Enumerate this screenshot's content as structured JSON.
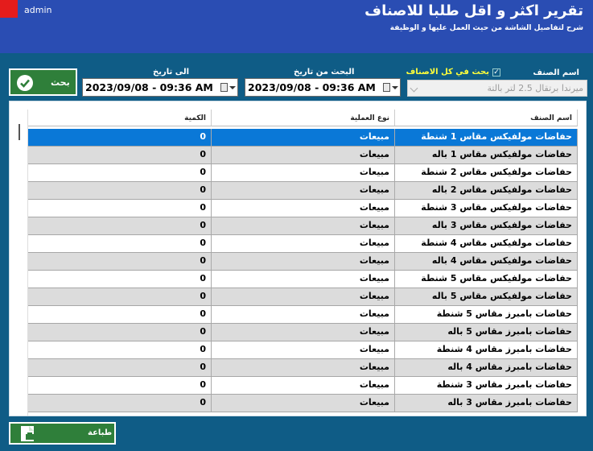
{
  "window": {
    "user": "admin"
  },
  "header": {
    "title": "تقرير اكثر و اقل طلبا للاصناف",
    "subtitle": "شرح لتفاصيل الشاشة من حيث العمل عليها و الوظيفة"
  },
  "toolbar": {
    "search_button_label": "بحث",
    "to_date_label": "الى تاريخ",
    "to_date_value": "2023/09/08 - 09:36 AM",
    "from_date_label": "البحث من تاريخ",
    "from_date_value": "2023/09/08 - 09:36 AM",
    "all_items_label": "بحث في كل الاصناف",
    "all_items_checked": true,
    "item_name_label": "اسم الصنف",
    "item_combo_value": "ميرندا برتقال 2.5 لتر بالتة"
  },
  "grid": {
    "columns": {
      "qty": "الكمية",
      "operation": "نوع العملية",
      "name": "اسم الصنف"
    },
    "rows": [
      {
        "name": "حفاضات مولفيكس مقاس 1  شنطة",
        "operation": "مبيعات",
        "qty": "0"
      },
      {
        "name": "حفاضات مولفيكس مقاس 1  باله",
        "operation": "مبيعات",
        "qty": "0"
      },
      {
        "name": "حفاضات مولفيكس مقاس 2  شنطة",
        "operation": "مبيعات",
        "qty": "0"
      },
      {
        "name": "حفاضات مولفيكس مقاس 2  باله",
        "operation": "مبيعات",
        "qty": "0"
      },
      {
        "name": "حفاضات مولفيكس مقاس 3  شنطة",
        "operation": "مبيعات",
        "qty": "0"
      },
      {
        "name": "حفاضات مولفيكس مقاس 3  باله",
        "operation": "مبيعات",
        "qty": "0"
      },
      {
        "name": "حفاضات مولفيكس مقاس 4  شنطة",
        "operation": "مبيعات",
        "qty": "0"
      },
      {
        "name": "حفاضات مولفيكس مقاس 4  باله",
        "operation": "مبيعات",
        "qty": "0"
      },
      {
        "name": "حفاضات مولفيكس مقاس 5  شنطة",
        "operation": "مبيعات",
        "qty": "0"
      },
      {
        "name": "حفاضات مولفيكس مقاس 5  باله",
        "operation": "مبيعات",
        "qty": "0"
      },
      {
        "name": "حفاضات بامبرز مقاس 5  شنطة",
        "operation": "مبيعات",
        "qty": "0"
      },
      {
        "name": "حفاضات بامبرز مقاس 5  باله",
        "operation": "مبيعات",
        "qty": "0"
      },
      {
        "name": "حفاضات بامبرز مقاس 4  شنطة",
        "operation": "مبيعات",
        "qty": "0"
      },
      {
        "name": "حفاضات بامبرز مقاس 4  باله",
        "operation": "مبيعات",
        "qty": "0"
      },
      {
        "name": "حفاضات بامبرز مقاس 3  شنطة",
        "operation": "مبيعات",
        "qty": "0"
      },
      {
        "name": "حفاضات بامبرز مقاس 3  باله",
        "operation": "مبيعات",
        "qty": "0"
      }
    ]
  },
  "footer": {
    "print_button_label": "طباعة"
  },
  "colors": {
    "background": "#0f5c86",
    "header": "#2a4db3",
    "button": "#2f7f3a",
    "selected_row": "#0a78d7",
    "checkbox_text": "#ffff3a"
  }
}
